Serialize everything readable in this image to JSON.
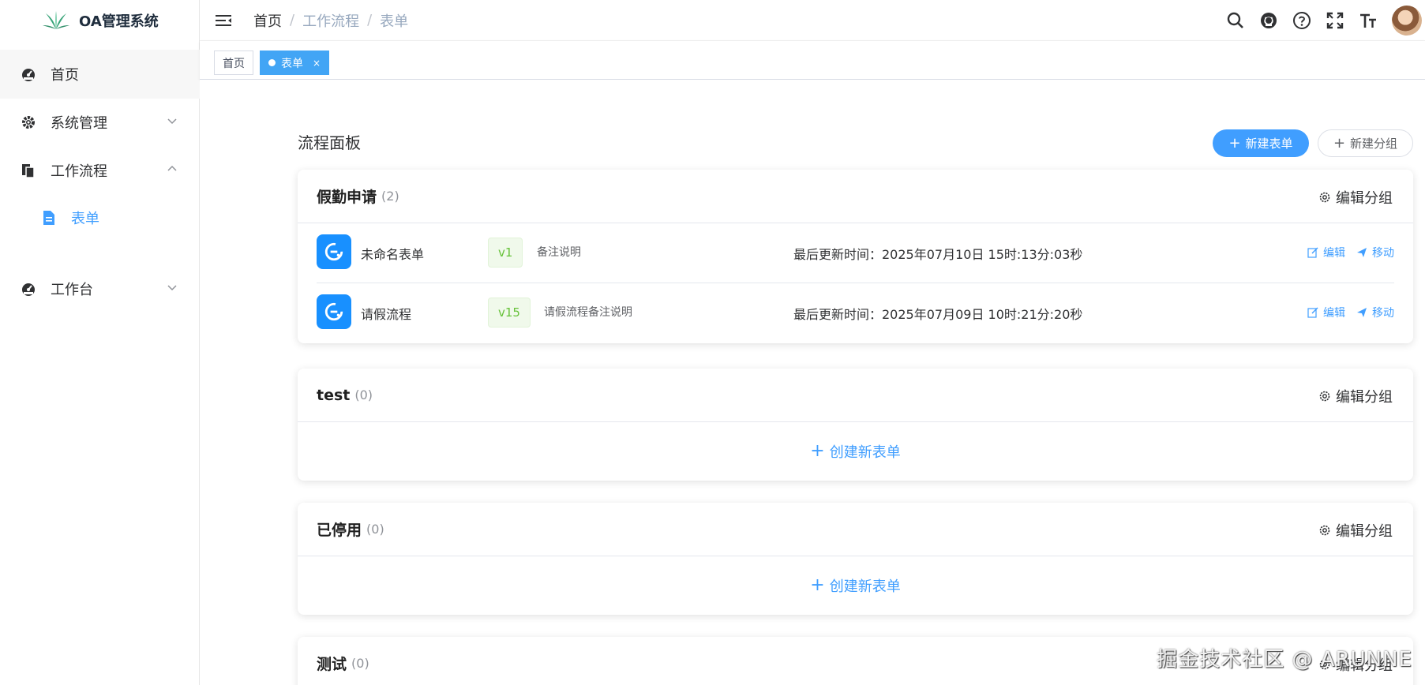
{
  "app": {
    "title": "OA管理系统"
  },
  "sidebar": {
    "items": [
      {
        "label": "首页",
        "icon": "dashboard-icon"
      },
      {
        "label": "系统管理",
        "icon": "gear-icon"
      },
      {
        "label": "工作流程",
        "icon": "documents-icon"
      },
      {
        "label": "表单",
        "icon": "file-icon"
      },
      {
        "label": "工作台",
        "icon": "dashboard-icon"
      }
    ]
  },
  "breadcrumb": {
    "home": "首页",
    "level1": "工作流程",
    "level2": "表单",
    "separator": "/"
  },
  "header": {
    "tools": [
      "search-icon",
      "github-icon",
      "help-icon",
      "fullscreen-icon",
      "font-size-icon"
    ]
  },
  "tags": {
    "home": "首页",
    "active": "表单",
    "close": "×"
  },
  "panel": {
    "title": "流程面板",
    "new_form": "新建表单",
    "new_group": "新建分组",
    "edit_group": "编辑分组",
    "create_new_form": "创建新表单",
    "edit": "编辑",
    "move": "移动"
  },
  "groups": [
    {
      "name": "假勤申请",
      "count": "(2)",
      "forms": [
        {
          "name": "未命名表单",
          "version": "v1",
          "remark": "备注说明",
          "updated": "最后更新时间：2025年07月10日 15时:13分:03秒"
        },
        {
          "name": "请假流程",
          "version": "v15",
          "remark": "请假流程备注说明",
          "updated": "最后更新时间：2025年07月09日 10时:21分:20秒"
        }
      ]
    },
    {
      "name": "test",
      "count": "(0)"
    },
    {
      "name": "已停用",
      "count": "(0)"
    },
    {
      "name": "测试",
      "count": "(0)"
    }
  ],
  "watermark": "掘金技术社区 @ ARUNNE",
  "colors": {
    "accent": "#409eff",
    "tag_active": "#42a5f5",
    "version_green": "#67c23a"
  }
}
